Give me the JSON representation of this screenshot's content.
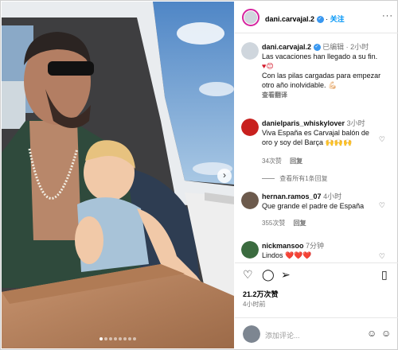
{
  "post": {
    "author": "dani.carvajal.2",
    "follow_label": "关注",
    "caption_meta": "已编辑 · 2小时",
    "caption_line1": "Las vacaciones han llegado a su fin.",
    "caption_emoji1": "♥😊",
    "caption_line2": "Con las pilas cargadas para empezar",
    "caption_line3": "otro año inolvidable. 💪🏻",
    "translate_label": "查看翻译",
    "likes": "21.2万次赞",
    "time": "4小时前",
    "add_comment_placeholder": "添加评论..."
  },
  "comments": [
    {
      "user": "danielparis_whiskylover",
      "time": "3小时",
      "text": "Viva España es Carvajal balón de oro y soy del Barça 🙌🙌🙌",
      "likes": "34次赞",
      "reply": "回复",
      "view_replies": "查看所有1条回复"
    },
    {
      "user": "hernan.ramos_07",
      "time": "4小时",
      "text": "Que grande el padre de España",
      "likes": "355次赞",
      "reply": "回复"
    },
    {
      "user": "nickmansoo",
      "time": "7分钟",
      "text": "Lindos ❤️❤️❤️"
    }
  ],
  "icons": {
    "more": "more-icon",
    "heart": "heart-icon",
    "comment": "comment-icon",
    "share": "share-icon",
    "bookmark": "bookmark-icon",
    "emoji": "emoji-icon",
    "next": "chevron-right-icon"
  },
  "colors": {
    "accent": "#0095f6",
    "verified": "#3897f0",
    "ring": "#d6249f"
  }
}
